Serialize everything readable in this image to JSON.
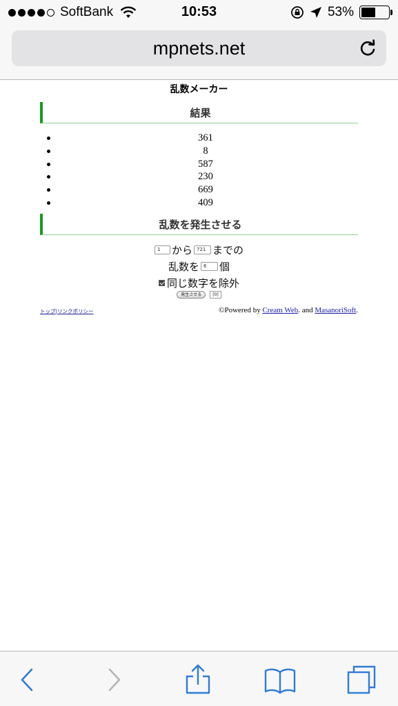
{
  "status_bar": {
    "carrier": "SoftBank",
    "time": "10:53",
    "battery_percent": "53%",
    "battery_level": 0.53,
    "signal_bars_filled": 4,
    "signal_bars_total": 5
  },
  "address_bar": {
    "url": "mpnets.net"
  },
  "page": {
    "title": "乱数メーカー",
    "results_heading": "結果",
    "results": [
      "361",
      "8",
      "587",
      "230",
      "669",
      "409"
    ],
    "generate_heading": "乱数を発生させる",
    "form": {
      "min_value": "1",
      "from_label": "から",
      "max_value": "721",
      "until_label": "までの",
      "count_prefix": "乱数を",
      "count_value": "6",
      "count_suffix": "個",
      "exclude_duplicates_label": "同じ数字を除外",
      "exclude_duplicates_checked": true,
      "generate_button": "発生させる",
      "counter_display": "[0]"
    },
    "footer": {
      "top_link": "トップ",
      "separator": "|",
      "link_policy": "リンクポリシー",
      "powered_by": "©Powered by",
      "cream_web": "Cream Web",
      "and": ". and",
      "masanori_soft": "MasanoriSoft",
      "end": "."
    }
  },
  "colors": {
    "section_accent": "#1a9a1a",
    "section_underline": "#8fd08f",
    "link": "#1a1aa8",
    "toolbar_active": "#2f7bd6",
    "toolbar_disabled": "#b4b4b4"
  },
  "toolbar": {
    "icons": [
      "back-icon",
      "forward-icon",
      "share-icon",
      "bookmarks-icon",
      "tabs-icon"
    ]
  }
}
